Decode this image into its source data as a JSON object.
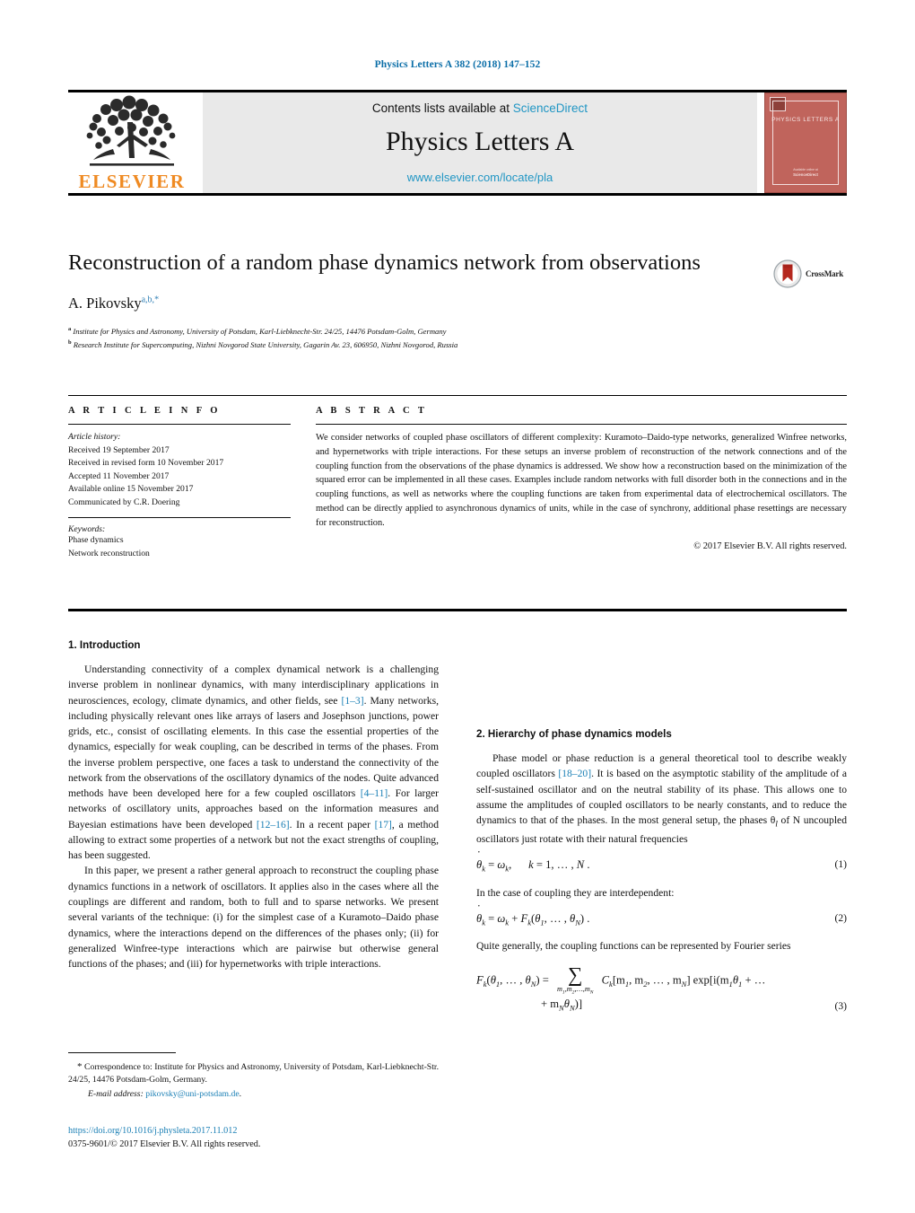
{
  "running_head": "Physics Letters A 382 (2018) 147–152",
  "masthead": {
    "contents_prefix": "Contents lists available at",
    "contents_link": "ScienceDirect",
    "journal_title": "Physics Letters A",
    "journal_url": "www.elsevier.com/locate/pla",
    "publisher_wordmark": "ELSEVIER",
    "cover_title": "PHYSICS LETTERS A",
    "cover_foot_small": "Available online at",
    "cover_foot_bold": "ScienceDirect",
    "link_color": "#2196c4",
    "cover_color": "#c0645c",
    "wordmark_color": "#ef8a22"
  },
  "article": {
    "title": "Reconstruction of a random phase dynamics network from observations",
    "author": "A. Pikovsky",
    "author_marks": "a,b,",
    "author_star": "*",
    "affiliations": [
      {
        "mark": "a",
        "text": "Institute for Physics and Astronomy, University of Potsdam, Karl-Liebknecht-Str. 24/25, 14476 Potsdam-Golm, Germany"
      },
      {
        "mark": "b",
        "text": "Research Institute for Supercomputing, Nizhni Novgorod State University, Gagarin Av. 23, 606950, Nizhni Novgorod, Russia"
      }
    ],
    "crossmark_label": "CrossMark"
  },
  "info": {
    "heading": "A R T I C L E    I N F O",
    "history_label": "Article history:",
    "history": [
      "Received 19 September 2017",
      "Received in revised form 10 November 2017",
      "Accepted 11 November 2017",
      "Available online 15 November 2017",
      "Communicated by C.R. Doering"
    ],
    "keywords_label": "Keywords:",
    "keywords": [
      "Phase dynamics",
      "Network reconstruction"
    ]
  },
  "abstract": {
    "heading": "A B S T R A C T",
    "text": "We consider networks of coupled phase oscillators of different complexity: Kuramoto–Daido-type networks, generalized Winfree networks, and hypernetworks with triple interactions. For these setups an inverse problem of reconstruction of the network connections and of the coupling function from the observations of the phase dynamics is addressed. We show how a reconstruction based on the minimization of the squared error can be implemented in all these cases. Examples include random networks with full disorder both in the connections and in the coupling functions, as well as networks where the coupling functions are taken from experimental data of electrochemical oscillators. The method can be directly applied to asynchronous dynamics of units, while in the case of synchrony, additional phase resettings are necessary for reconstruction.",
    "copyright": "© 2017 Elsevier B.V. All rights reserved."
  },
  "body": {
    "section1_heading": "1. Introduction",
    "intro_p1_a": "Understanding connectivity of a complex dynamical network is a challenging inverse problem in nonlinear dynamics, with many interdisciplinary applications in neurosciences, ecology, climate dynamics, and other fields, see ",
    "intro_p1_ref1": "[1–3]",
    "intro_p1_b": ". Many networks, including physically relevant ones like arrays of lasers and Josephson junctions, power grids, etc., consist of oscillating elements. In this case the essential properties of the dynamics, especially for weak coupling, can be described in terms of the phases. From the inverse problem perspective, one faces a task to understand the connectivity of the network from the observations of the oscillatory dynamics of the nodes. Quite advanced methods have been developed here for a few coupled oscillators ",
    "intro_p1_ref2": "[4–11]",
    "intro_p1_c": ". For larger networks of oscillatory units, approaches based on the information measures and Bayesian estimations have been developed ",
    "intro_p1_ref3": "[12–16]",
    "intro_p1_d": ". In a recent paper ",
    "intro_p1_ref4": "[17]",
    "intro_p1_e": ", a method allowing to extract some properties of a network but not the exact strengths of coupling, has been suggested.",
    "intro_p2": "In this paper, we present a rather general approach to reconstruct the coupling phase dynamics functions in a network of oscillators. It applies also in the cases where all the couplings are different and random, both to full and to sparse networks. We present several variants of the technique: (i) for the simplest case of a Kuramoto–Daido phase dynamics, where the interactions depend on the differences of the phases only; (ii) for generalized Winfree-type interactions which are pairwise but otherwise general functions of the phases; and (iii) for hypernetworks with triple interactions.",
    "section2_heading": "2. Hierarchy of phase dynamics models",
    "sec2_p1_a": "Phase model or phase reduction is a general theoretical tool to describe weakly coupled oscillators ",
    "sec2_p1_ref": "[18–20]",
    "sec2_p1_b": ". It is based on the asymptotic stability of the amplitude of a self-sustained oscillator and on the neutral stability of its phase. This allows one to assume the amplitudes of coupled oscillators to be nearly constants, and to reduce the dynamics to that of the phases. In the most general setup, the phases θ",
    "sec2_p1_sub": "l",
    "sec2_p1_c": " of N uncoupled oscillators just rotate with their natural frequencies",
    "eq1_number": "(1)",
    "eq2_number": "(2)",
    "eq3_number": "(3)",
    "between_eq1_eq2": "In the case of coupling they are interdependent:",
    "after_eq2": "Quite generally, the coupling functions can be represented by Fourier series"
  },
  "footnote": {
    "star": "*",
    "correspondence": "Correspondence to: Institute for Physics and Astronomy, University of Potsdam, Karl-Liebknecht-Str. 24/25, 14476 Potsdam-Golm, Germany.",
    "email_label": "E-mail address:",
    "email": "pikovsky@uni-potsdam.de",
    "email_suffix": "."
  },
  "publisher_footer": {
    "doi": "https://doi.org/10.1016/j.physleta.2017.11.012",
    "issn_line": "0375-9601/© 2017 Elsevier B.V. All rights reserved."
  }
}
